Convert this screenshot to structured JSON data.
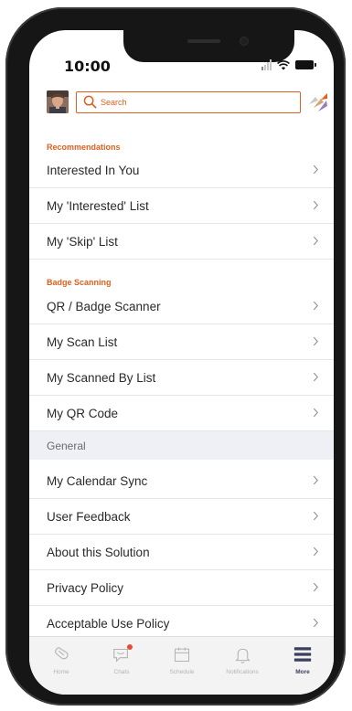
{
  "status_bar": {
    "time": "10:00"
  },
  "header": {
    "search_placeholder": "Search"
  },
  "sections": {
    "recommendations": {
      "title": "Recommendations",
      "items": [
        "Interested In You",
        "My 'Interested' List",
        "My 'Skip' List"
      ]
    },
    "badge_scanning": {
      "title": "Badge Scanning",
      "items": [
        "QR / Badge Scanner",
        "My Scan List",
        "My Scanned By List",
        "My QR Code"
      ]
    },
    "general": {
      "title": "General",
      "items": [
        "My Calendar Sync",
        "User Feedback",
        "About this Solution",
        "Privacy Policy",
        "Acceptable Use Policy"
      ]
    }
  },
  "tabbar": {
    "tabs": [
      {
        "label": "Home",
        "icon": "home-icon"
      },
      {
        "label": "Chats",
        "icon": "chat-icon"
      },
      {
        "label": "Schedule",
        "icon": "calendar-icon"
      },
      {
        "label": "Notifications",
        "icon": "bell-icon"
      },
      {
        "label": "More",
        "icon": "menu-icon"
      }
    ],
    "active": "More"
  },
  "colors": {
    "accent": "#e0601e",
    "general_band": "#eff0f6",
    "tab_active": "#3a3f5c",
    "tab_inactive": "#b3b3b3",
    "chat_badge": "#e84a3a"
  }
}
